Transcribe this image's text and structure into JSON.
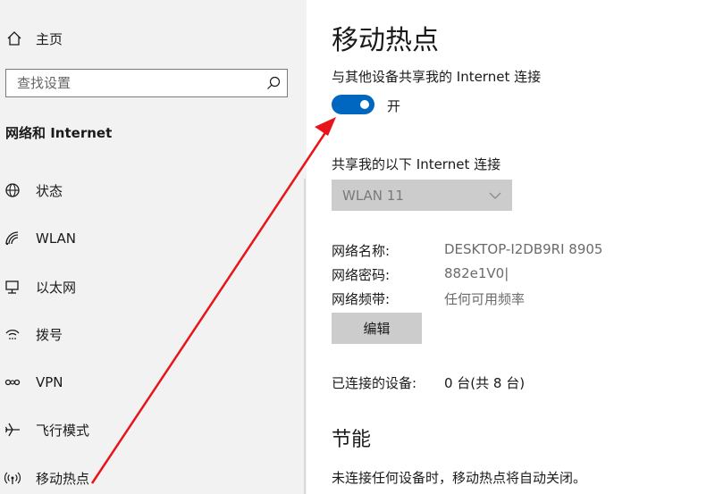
{
  "sidebar": {
    "home_label": "主页",
    "search_placeholder": "查找设置",
    "section_title": "网络和 Internet",
    "items": [
      {
        "label": "状态",
        "icon": "globe-icon"
      },
      {
        "label": "WLAN",
        "icon": "wifi-icon"
      },
      {
        "label": "以太网",
        "icon": "ethernet-icon"
      },
      {
        "label": "拨号",
        "icon": "dialup-icon"
      },
      {
        "label": "VPN",
        "icon": "vpn-icon"
      },
      {
        "label": "飞行模式",
        "icon": "airplane-icon"
      },
      {
        "label": "移动热点",
        "icon": "hotspot-icon",
        "selected": true
      }
    ]
  },
  "main": {
    "title": "移动热点",
    "share_label": "与其他设备共享我的 Internet 连接",
    "toggle": {
      "on": true,
      "state_label": "开"
    },
    "share_from_label": "共享我的以下 Internet 连接",
    "share_from_value": "WLAN 11",
    "network_info": [
      {
        "key": "网络名称:",
        "value": "DESKTOP-I2DB9RI 8905"
      },
      {
        "key": "网络密码:",
        "value": "882e1V0|"
      },
      {
        "key": "网络频带:",
        "value": "任何可用频率"
      }
    ],
    "edit_label": "编辑",
    "devices_key": "已连接的设备:",
    "devices_value": "0 台(共 8 台)",
    "power_saving_title": "节能",
    "power_saving_note": "未连接任何设备时，移动热点将自动关闭。"
  },
  "colors": {
    "accent": "#0067c0",
    "annotation_arrow": "#e8141c",
    "sidebar_bg": "#f2f2f2",
    "disabled_control": "#cccccc"
  }
}
